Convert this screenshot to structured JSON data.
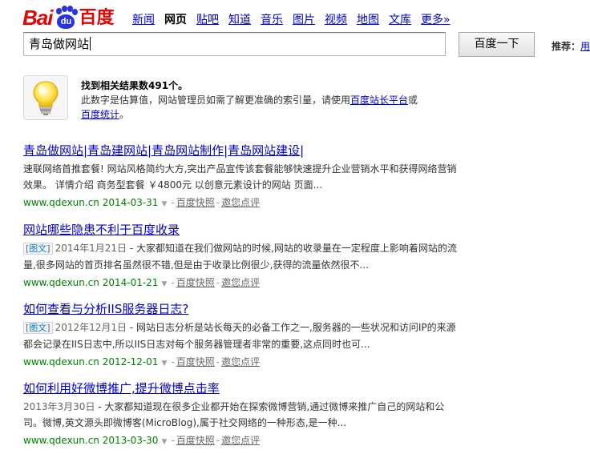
{
  "header": {
    "logo": {
      "latin": "Bai",
      "paw": "du",
      "cn": "百度"
    },
    "nav": [
      {
        "label": "新闻",
        "current": false
      },
      {
        "label": "网页",
        "current": true
      },
      {
        "label": "贴吧",
        "current": false
      },
      {
        "label": "知道",
        "current": false
      },
      {
        "label": "音乐",
        "current": false
      },
      {
        "label": "图片",
        "current": false
      },
      {
        "label": "视频",
        "current": false
      },
      {
        "label": "地图",
        "current": false
      },
      {
        "label": "文库",
        "current": false
      },
      {
        "label": "更多»",
        "current": false
      }
    ]
  },
  "search": {
    "query": "青岛做网站",
    "button_label": "百度一下",
    "recommend_label": "推荐：",
    "recommend_link": "用"
  },
  "tip": {
    "prefix": "找到相关结果数",
    "count": "491",
    "suffix": "个。",
    "line2_prefix": "此数字是估算值，网站管理员如需了解更准确的索引量，请使用",
    "link1": "百度站长平台",
    "line2_suffix": "或",
    "link2": "百度统计",
    "line3_suffix": "。"
  },
  "results": [
    {
      "title": "青岛做网站|青岛建网站|青岛网站制作|青岛网站建设|",
      "badge": "",
      "date": "",
      "abstract": "速联网络首推套餐! 网站风格简约大方,突出产品宣传该套餐能够快速提升企业营销水平和获得网络营销效果。 详情介绍 商务型套餐 ￥4800元 以创意元素设计的网站 页面...",
      "url": "www.qdexun.cn 2014-03-31",
      "snapshot": "百度快照",
      "review": "邀您点评"
    },
    {
      "title": "网站哪些隐患不利于百度收录",
      "badge": "图文",
      "date": "2014年1月21日",
      "abstract": " - 大家都知道在我们做网站的时候,网站的收录量在一定程度上影响着网站的流量,很多网站的首页排名虽然很不错,但是由于收录比例很少,获得的流量依然很不...",
      "url": "www.qdexun.cn 2014-01-21",
      "snapshot": "百度快照",
      "review": "邀您点评"
    },
    {
      "title": "如何查看与分析IIS服务器日志?",
      "badge": "图文",
      "date": "2012年12月1日",
      "abstract": " - 网站日志分析是站长每天的必备工作之一,服务器的一些状况和访问IP的来源都会记录在IIS日志中,所以IIS日志对每个服务器管理者非常的重要,这点同时也可...",
      "url": "www.qdexun.cn 2012-12-01",
      "snapshot": "百度快照",
      "review": "邀您点评"
    },
    {
      "title": "如何利用好微博推广,提升微博点击率",
      "badge": "",
      "date": "2013年3月30日",
      "abstract": " - 大家都知道现在很多企业都开始在探索微博营销,通过微博来推广自己的网站和公司。微博,英文源头即微博客(MicroBlog),属于社交网络的一种形态,是一种...",
      "url": "www.qdexun.cn 2013-03-30",
      "snapshot": "百度快照",
      "review": "邀您点评"
    }
  ],
  "colors": {
    "brand_red": "#e10601",
    "brand_blue": "#2932e1",
    "link": "#0000cc",
    "url_green": "#008000"
  }
}
